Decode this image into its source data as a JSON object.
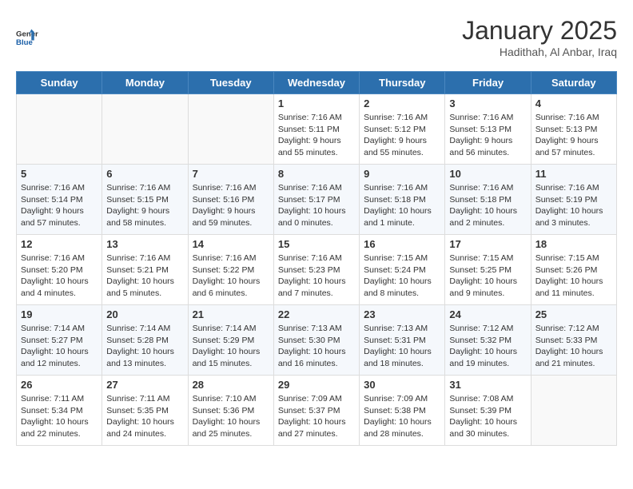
{
  "header": {
    "logo_line1": "General",
    "logo_line2": "Blue",
    "month": "January 2025",
    "location": "Hadithah, Al Anbar, Iraq"
  },
  "weekdays": [
    "Sunday",
    "Monday",
    "Tuesday",
    "Wednesday",
    "Thursday",
    "Friday",
    "Saturday"
  ],
  "weeks": [
    [
      {
        "day": "",
        "info": ""
      },
      {
        "day": "",
        "info": ""
      },
      {
        "day": "",
        "info": ""
      },
      {
        "day": "1",
        "info": "Sunrise: 7:16 AM\nSunset: 5:11 PM\nDaylight: 9 hours\nand 55 minutes."
      },
      {
        "day": "2",
        "info": "Sunrise: 7:16 AM\nSunset: 5:12 PM\nDaylight: 9 hours\nand 55 minutes."
      },
      {
        "day": "3",
        "info": "Sunrise: 7:16 AM\nSunset: 5:13 PM\nDaylight: 9 hours\nand 56 minutes."
      },
      {
        "day": "4",
        "info": "Sunrise: 7:16 AM\nSunset: 5:13 PM\nDaylight: 9 hours\nand 57 minutes."
      }
    ],
    [
      {
        "day": "5",
        "info": "Sunrise: 7:16 AM\nSunset: 5:14 PM\nDaylight: 9 hours\nand 57 minutes."
      },
      {
        "day": "6",
        "info": "Sunrise: 7:16 AM\nSunset: 5:15 PM\nDaylight: 9 hours\nand 58 minutes."
      },
      {
        "day": "7",
        "info": "Sunrise: 7:16 AM\nSunset: 5:16 PM\nDaylight: 9 hours\nand 59 minutes."
      },
      {
        "day": "8",
        "info": "Sunrise: 7:16 AM\nSunset: 5:17 PM\nDaylight: 10 hours\nand 0 minutes."
      },
      {
        "day": "9",
        "info": "Sunrise: 7:16 AM\nSunset: 5:18 PM\nDaylight: 10 hours\nand 1 minute."
      },
      {
        "day": "10",
        "info": "Sunrise: 7:16 AM\nSunset: 5:18 PM\nDaylight: 10 hours\nand 2 minutes."
      },
      {
        "day": "11",
        "info": "Sunrise: 7:16 AM\nSunset: 5:19 PM\nDaylight: 10 hours\nand 3 minutes."
      }
    ],
    [
      {
        "day": "12",
        "info": "Sunrise: 7:16 AM\nSunset: 5:20 PM\nDaylight: 10 hours\nand 4 minutes."
      },
      {
        "day": "13",
        "info": "Sunrise: 7:16 AM\nSunset: 5:21 PM\nDaylight: 10 hours\nand 5 minutes."
      },
      {
        "day": "14",
        "info": "Sunrise: 7:16 AM\nSunset: 5:22 PM\nDaylight: 10 hours\nand 6 minutes."
      },
      {
        "day": "15",
        "info": "Sunrise: 7:16 AM\nSunset: 5:23 PM\nDaylight: 10 hours\nand 7 minutes."
      },
      {
        "day": "16",
        "info": "Sunrise: 7:15 AM\nSunset: 5:24 PM\nDaylight: 10 hours\nand 8 minutes."
      },
      {
        "day": "17",
        "info": "Sunrise: 7:15 AM\nSunset: 5:25 PM\nDaylight: 10 hours\nand 9 minutes."
      },
      {
        "day": "18",
        "info": "Sunrise: 7:15 AM\nSunset: 5:26 PM\nDaylight: 10 hours\nand 11 minutes."
      }
    ],
    [
      {
        "day": "19",
        "info": "Sunrise: 7:14 AM\nSunset: 5:27 PM\nDaylight: 10 hours\nand 12 minutes."
      },
      {
        "day": "20",
        "info": "Sunrise: 7:14 AM\nSunset: 5:28 PM\nDaylight: 10 hours\nand 13 minutes."
      },
      {
        "day": "21",
        "info": "Sunrise: 7:14 AM\nSunset: 5:29 PM\nDaylight: 10 hours\nand 15 minutes."
      },
      {
        "day": "22",
        "info": "Sunrise: 7:13 AM\nSunset: 5:30 PM\nDaylight: 10 hours\nand 16 minutes."
      },
      {
        "day": "23",
        "info": "Sunrise: 7:13 AM\nSunset: 5:31 PM\nDaylight: 10 hours\nand 18 minutes."
      },
      {
        "day": "24",
        "info": "Sunrise: 7:12 AM\nSunset: 5:32 PM\nDaylight: 10 hours\nand 19 minutes."
      },
      {
        "day": "25",
        "info": "Sunrise: 7:12 AM\nSunset: 5:33 PM\nDaylight: 10 hours\nand 21 minutes."
      }
    ],
    [
      {
        "day": "26",
        "info": "Sunrise: 7:11 AM\nSunset: 5:34 PM\nDaylight: 10 hours\nand 22 minutes."
      },
      {
        "day": "27",
        "info": "Sunrise: 7:11 AM\nSunset: 5:35 PM\nDaylight: 10 hours\nand 24 minutes."
      },
      {
        "day": "28",
        "info": "Sunrise: 7:10 AM\nSunset: 5:36 PM\nDaylight: 10 hours\nand 25 minutes."
      },
      {
        "day": "29",
        "info": "Sunrise: 7:09 AM\nSunset: 5:37 PM\nDaylight: 10 hours\nand 27 minutes."
      },
      {
        "day": "30",
        "info": "Sunrise: 7:09 AM\nSunset: 5:38 PM\nDaylight: 10 hours\nand 28 minutes."
      },
      {
        "day": "31",
        "info": "Sunrise: 7:08 AM\nSunset: 5:39 PM\nDaylight: 10 hours\nand 30 minutes."
      },
      {
        "day": "",
        "info": ""
      }
    ]
  ]
}
